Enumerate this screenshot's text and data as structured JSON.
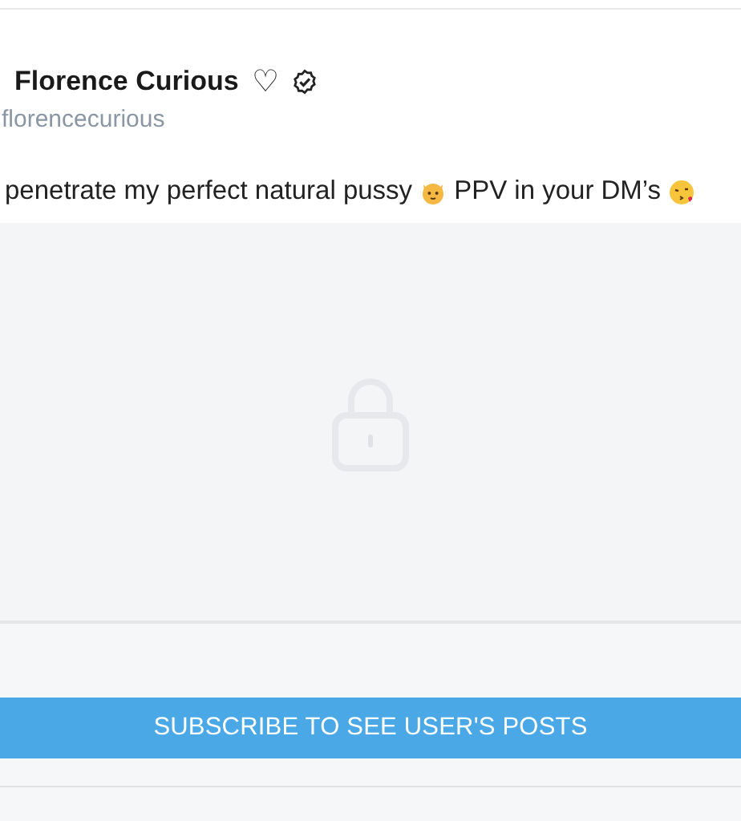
{
  "author": {
    "name": "Florence Curious",
    "heart": "♡",
    "verified": true,
    "handle": "florencecurious"
  },
  "post": {
    "parts": [
      {
        "kind": "text",
        "text": "penetrate my perfect natural pussy"
      },
      {
        "kind": "cat"
      },
      {
        "kind": "text",
        "text": "PPV in your DM’s"
      },
      {
        "kind": "kiss"
      }
    ],
    "locked": true
  },
  "subscribe_button": "SUBSCRIBE TO SEE USER'S POSTS"
}
